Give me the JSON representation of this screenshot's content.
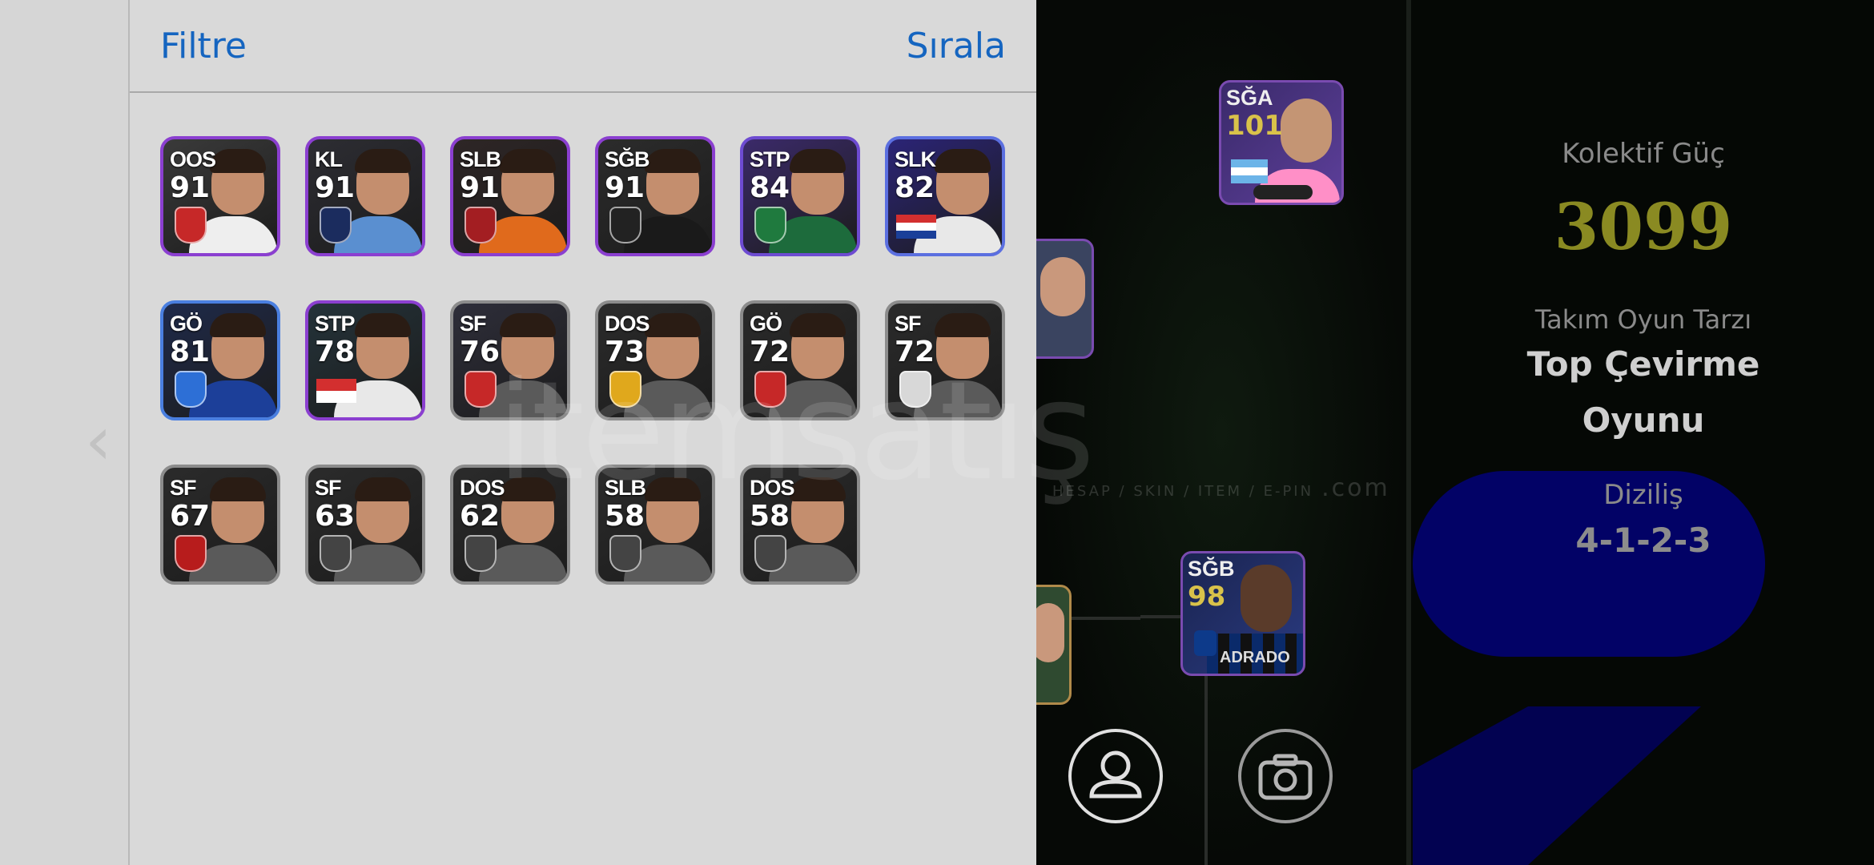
{
  "header": {
    "filter_label": "Filtre",
    "sort_label": "Sırala"
  },
  "players": [
    {
      "pos": "OOS",
      "rating": "91",
      "border": "#8b3fd0",
      "bg": "#3a3a3a",
      "shirt": "#eeeeee",
      "badge": "#c62828",
      "kind": "club"
    },
    {
      "pos": "KL",
      "rating": "91",
      "border": "#8b3fd0",
      "bg": "#2d2d33",
      "shirt": "#5a8fd0",
      "badge": "#1b2c5e",
      "kind": "club"
    },
    {
      "pos": "SLB",
      "rating": "91",
      "border": "#8b3fd0",
      "bg": "#2e2626",
      "shirt": "#e06a1c",
      "badge": "#a31e22",
      "kind": "club"
    },
    {
      "pos": "SĞB",
      "rating": "91",
      "border": "#8b3fd0",
      "bg": "#2c2c2c",
      "shirt": "#1a1a1a",
      "badge": "#222222",
      "kind": "club"
    },
    {
      "pos": "STP",
      "rating": "84",
      "border": "#6d4bd1",
      "bg": "#3b2a6a",
      "shirt": "#1d6b3c",
      "badge": "#1f7a3e",
      "kind": "club"
    },
    {
      "pos": "SLK",
      "rating": "82",
      "border": "#5b6fe0",
      "bg": "#2b2477",
      "shirt": "#e8e8e8",
      "badge": "#c0392b",
      "kind": "flag-hr"
    },
    {
      "pos": "GÖ",
      "rating": "81",
      "border": "#4a7fe0",
      "bg": "#1f2a4a",
      "shirt": "#1c3f99",
      "badge": "#2d6fd6",
      "kind": "club"
    },
    {
      "pos": "STP",
      "rating": "78",
      "border": "#8b3fd0",
      "bg": "#24333a",
      "shirt": "#e8e8e8",
      "badge": "#d32f2f",
      "kind": "flag-id"
    },
    {
      "pos": "SF",
      "rating": "76",
      "border": "#8c8c8c",
      "bg": "#2e2e3a",
      "shirt": "#5a5a5a",
      "badge": "#c62828",
      "kind": "club"
    },
    {
      "pos": "DOS",
      "rating": "73",
      "border": "#8c8c8c",
      "bg": "#2b2b2b",
      "shirt": "#5a5a5a",
      "badge": "#e0a81c",
      "kind": "club"
    },
    {
      "pos": "GÖ",
      "rating": "72",
      "border": "#8c8c8c",
      "bg": "#2b2b2b",
      "shirt": "#5a5a5a",
      "badge": "#c62828",
      "kind": "club"
    },
    {
      "pos": "SF",
      "rating": "72",
      "border": "#8c8c8c",
      "bg": "#2b2b2b",
      "shirt": "#5a5a5a",
      "badge": "#d8d8d8",
      "kind": "club"
    },
    {
      "pos": "SF",
      "rating": "67",
      "border": "#8c8c8c",
      "bg": "#2b2b2b",
      "shirt": "#5a5a5a",
      "badge": "#b71c1c",
      "kind": "club"
    },
    {
      "pos": "SF",
      "rating": "63",
      "border": "#8c8c8c",
      "bg": "#2b2b2b",
      "shirt": "#5a5a5a",
      "badge": "#444444",
      "kind": "club"
    },
    {
      "pos": "DOS",
      "rating": "62",
      "border": "#8c8c8c",
      "bg": "#2b2b2b",
      "shirt": "#5a5a5a",
      "badge": "#444444",
      "kind": "club"
    },
    {
      "pos": "SLB",
      "rating": "58",
      "border": "#8c8c8c",
      "bg": "#2b2b2b",
      "shirt": "#5a5a5a",
      "badge": "#444444",
      "kind": "club"
    },
    {
      "pos": "DOS",
      "rating": "58",
      "border": "#8c8c8c",
      "bg": "#2b2b2b",
      "shirt": "#5a5a5a",
      "badge": "#444444",
      "kind": "club"
    }
  ],
  "squad": {
    "card1": {
      "pos": "SĞA",
      "rating": "101"
    },
    "card2": {
      "pos": "SĞB",
      "rating": "98",
      "name": "ADRADO"
    }
  },
  "team_info": {
    "strength_label": "Kolektif Güç",
    "strength_value": "3099",
    "style_label": "Takım Oyun Tarzı",
    "style_line1": "Top Çevirme",
    "style_line2": "Oyunu",
    "formation_label": "Diziliş",
    "formation_value": "4-1-2-3"
  },
  "watermark": {
    "main": "itemsatış",
    "sub": "HESAP / SKIN / ITEM / E-PIN",
    "domain": ".com"
  },
  "colors": {
    "accent": "#1565c0",
    "strength": "#8a8a22"
  }
}
